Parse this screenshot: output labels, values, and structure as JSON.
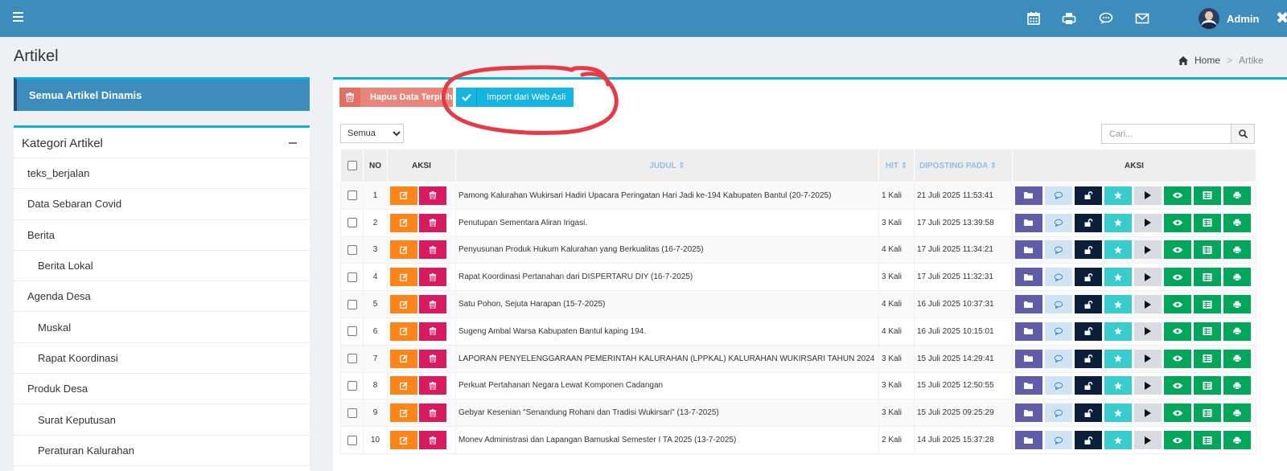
{
  "header": {
    "user_name": "Admin",
    "icons": [
      "menu-icon",
      "calendar-icon",
      "print-icon",
      "chat-icon",
      "mail-icon",
      "close-icon"
    ]
  },
  "page": {
    "title": "Artikel",
    "breadcrumb": {
      "home": "Home",
      "separator": ">",
      "current": "Artike"
    }
  },
  "sidebar": {
    "all_articles": "Semua Artikel Dinamis",
    "category_title": "Kategori Artikel",
    "categories": [
      {
        "label": "teks_berjalan",
        "sub": false
      },
      {
        "label": "Data Sebaran Covid",
        "sub": false
      },
      {
        "label": "Berita",
        "sub": false
      },
      {
        "label": "Berita Lokal",
        "sub": true
      },
      {
        "label": "Agenda Desa",
        "sub": false
      },
      {
        "label": "Muskal",
        "sub": true
      },
      {
        "label": "Rapat Koordinasi",
        "sub": true
      },
      {
        "label": "Produk Desa",
        "sub": false
      },
      {
        "label": "Surat Keputusan",
        "sub": true
      },
      {
        "label": "Peraturan Kalurahan",
        "sub": true
      }
    ]
  },
  "toolbar": {
    "delete_label": "Hapus Data Terpilih",
    "import_label": "Import dari Web Asli",
    "annotation_color": "#e63a45"
  },
  "filter": {
    "selected": "Semua"
  },
  "search": {
    "placeholder": "Cari..."
  },
  "table": {
    "headers": {
      "no": "NO",
      "aksi": "AKSI",
      "judul": "JUDUL",
      "hit": "HIT",
      "diposting": "DIPOSTING PADA",
      "aksi2": "AKSI"
    },
    "sort_marker": "⇕",
    "rows": [
      {
        "no": "1",
        "judul": "Pamong Kalurahan Wukirsari Hadiri Upacara Peringatan Hari Jadi ke-194 Kabupaten Bantul (20-7-2025)",
        "hit": "1 Kali",
        "tanggal": "21 Juli 2025 11:53:41"
      },
      {
        "no": "2",
        "judul": "Penutupan Sementara Aliran Irigasi.",
        "hit": "3 Kali",
        "tanggal": "17 Juli 2025 13:39:58"
      },
      {
        "no": "3",
        "judul": "Penyusunan Produk Hukum Kalurahan yang Berkualitas (16-7-2025)",
        "hit": "4 Kali",
        "tanggal": "17 Juli 2025 11:34:21"
      },
      {
        "no": "4",
        "judul": "Rapat Koordinasi Pertanahan dari DISPERTARU DIY (16-7-2025)",
        "hit": "3 Kali",
        "tanggal": "17 Juli 2025 11:32:31"
      },
      {
        "no": "5",
        "judul": "Satu Pohon, Sejuta Harapan (15-7-2025)",
        "hit": "4 Kali",
        "tanggal": "16 Juli 2025 10:37:31"
      },
      {
        "no": "6",
        "judul": "Sugeng Ambal Warsa Kabupaten Bantul kaping 194.",
        "hit": "4 Kali",
        "tanggal": "16 Juli 2025 10:15:01"
      },
      {
        "no": "7",
        "judul": "LAPORAN PENYELENGGARAAN PEMERINTAH KALURAHAN (LPPKAL) KALURAHAN WUKIRSARI TAHUN 2024",
        "hit": "3 Kali",
        "tanggal": "15 Juli 2025 14:29:41"
      },
      {
        "no": "8",
        "judul": "Perkuat Pertahanan Negara Lewat Komponen Cadangan",
        "hit": "3 Kali",
        "tanggal": "15 Juli 2025 12:50:55"
      },
      {
        "no": "9",
        "judul": "Gebyar Kesenian \"Senandung Rohani dan Tradisi Wukirsari\" (13-7-2025)",
        "hit": "3 Kali",
        "tanggal": "15 Juli 2025 09:25:29"
      },
      {
        "no": "10",
        "judul": "Monev Administrasi dan Lapangan Bamuskal Semester I TA 2025 (13-7-2025)",
        "hit": "2 Kali",
        "tanggal": "14 Juli 2025 15:37:28"
      }
    ]
  }
}
